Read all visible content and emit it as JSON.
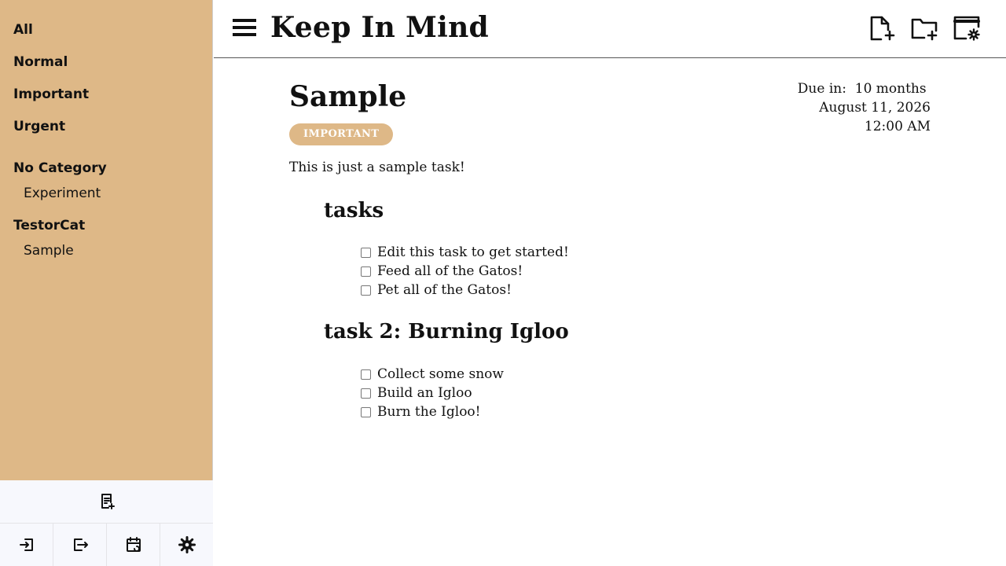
{
  "app": {
    "title": "Keep In Mind"
  },
  "sidebar": {
    "filters": [
      {
        "label": "All"
      },
      {
        "label": "Normal"
      },
      {
        "label": "Important"
      },
      {
        "label": "Urgent"
      }
    ],
    "categories": [
      {
        "name": "No Category",
        "items": [
          "Experiment"
        ]
      },
      {
        "name": "TestorCat",
        "items": [
          "Sample"
        ]
      }
    ],
    "bottom_icons": [
      "add-note-icon",
      "login-icon",
      "logout-icon",
      "calendar-sync-icon",
      "gear-icon"
    ]
  },
  "header": {
    "menu_icon": "hamburger-menu-icon",
    "actions": [
      "new-file-icon",
      "new-folder-icon",
      "window-settings-icon"
    ]
  },
  "task": {
    "title": "Sample",
    "priority": "IMPORTANT",
    "due_label": "Due in:",
    "due_relative": "10 months",
    "due_date": "August 11, 2026",
    "due_time": "12:00 AM",
    "description": "This is just a sample task!",
    "sections": [
      {
        "title": "tasks",
        "items": [
          "Edit this task to get started!",
          "Feed all of the Gatos!",
          "Pet all of the Gatos!"
        ]
      },
      {
        "title": "task 2: Burning Igloo",
        "items": [
          "Collect some snow",
          "Build an Igloo",
          "Burn the Igloo!"
        ]
      }
    ]
  },
  "colors": {
    "sidebar_bg": "#deb887",
    "badge_bg": "#deb887",
    "bottom_bar_bg": "#f7f8fd"
  }
}
